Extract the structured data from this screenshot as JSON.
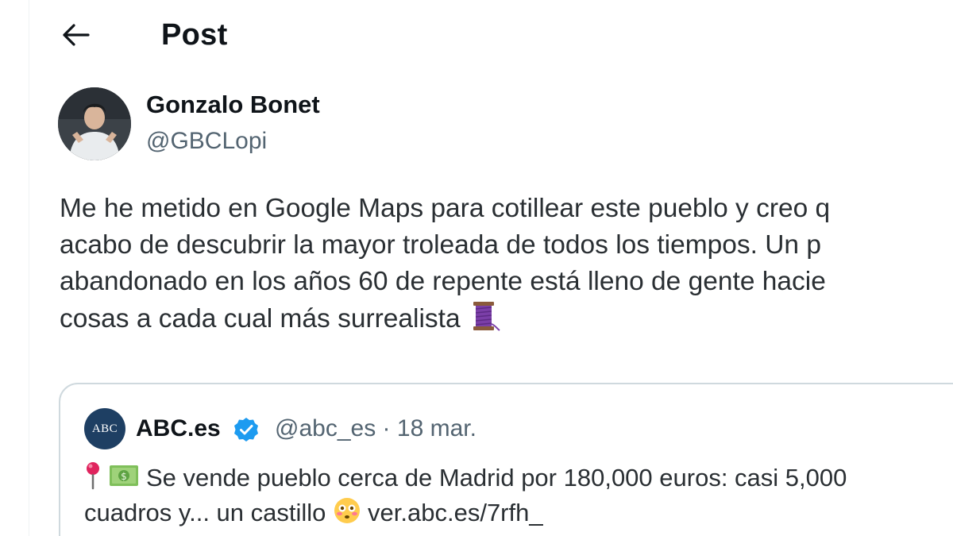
{
  "header": {
    "title": "Post",
    "back_icon": "arrow-left-icon"
  },
  "author": {
    "name": "Gonzalo Bonet",
    "handle": "@GBCLopi",
    "avatar_icon": "user-avatar"
  },
  "post": {
    "lines": [
      "Me he metido en Google Maps para cotillear este pueblo y creo q",
      "acabo de descubrir la mayor troleada de todos los tiempos. Un p",
      "abandonado en los años 60 de repente está lleno de gente hacie",
      "cosas a cada cual más surrealista"
    ],
    "trailing_emoji": "thread-spool-icon"
  },
  "quote": {
    "logo_text": "ABC",
    "name": "ABC.es",
    "verified_icon": "verified-badge-icon",
    "handle": "@abc_es",
    "separator": "·",
    "date": "18 mar.",
    "lines": [
      "Se vende pueblo cerca de Madrid por 180,000 euros: casi 5,000",
      "cuadros y... un castillo"
    ],
    "link": "ver.abc.es/7rfh_",
    "leading_emojis": [
      "round-pushpin-icon",
      "dollar-banknote-icon"
    ],
    "inline_emoji": "flushed-face-icon"
  },
  "colors": {
    "text_primary": "#0f1419",
    "text_secondary": "#536471",
    "border": "#cfd9de",
    "verified_blue": "#1d9bf0",
    "abc_blue": "#1e3f63"
  }
}
